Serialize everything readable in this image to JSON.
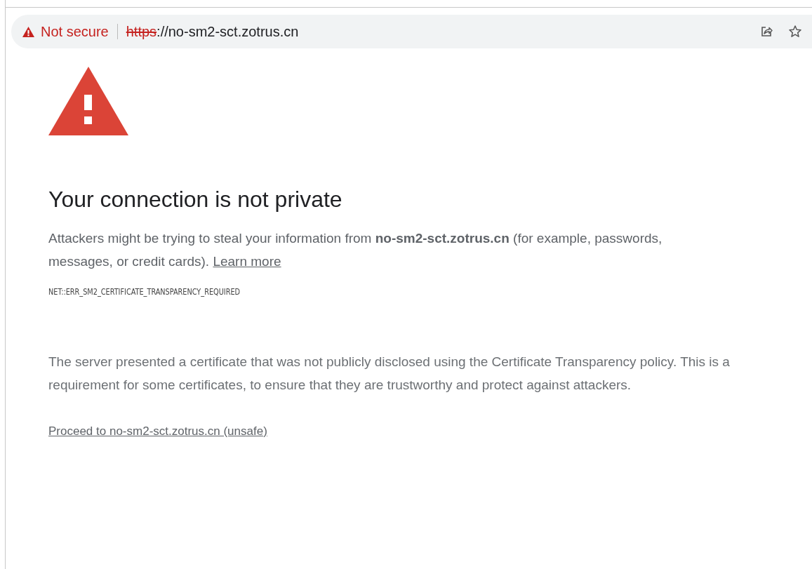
{
  "address_bar": {
    "security_label": "Not secure",
    "url_scheme": "https",
    "url_rest": "://no-sm2-sct.zotrus.cn"
  },
  "heading": "Your connection is not private",
  "message": "Attackers might be trying to steal your information from **no-sm2-sct.zotrus.cn** (for example, passwords, messages, or credit cards).",
  "learn_more": "Learn more",
  "error_code": "NET::ERR_SM2_CERTIFICATE_TRANSPARENCY_REQUIRED",
  "details": "The server presented a certificate that was not publicly disclosed using the Certificate Transparency policy. This is a requirement for some certificates, to ensure that they are trustworthy and protect against attackers.",
  "proceed_link": "Proceed to no-sm2-sct.zotrus.cn (unsafe)"
}
